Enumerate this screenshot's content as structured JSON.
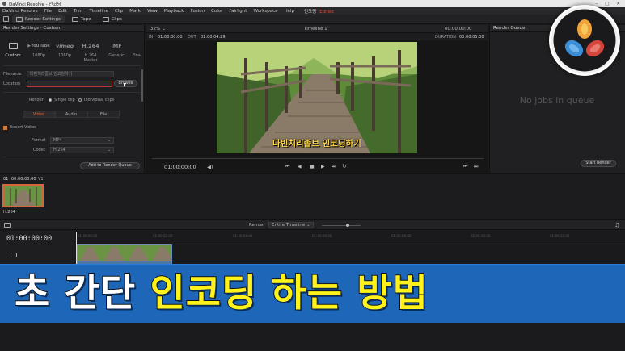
{
  "window": {
    "title": "DaVinci Resolve - 인코딩",
    "controls": [
      "–",
      "□",
      "✕"
    ]
  },
  "menu": {
    "items": [
      "DaVinci Resolve",
      "File",
      "Edit",
      "Trim",
      "Timeline",
      "Clip",
      "Mark",
      "View",
      "Playback",
      "Fusion",
      "Color",
      "Fairlight",
      "Workspace",
      "Help"
    ],
    "project_name": "인코딩",
    "edited_label": "Edited"
  },
  "page_tabs": {
    "render_settings": "Render Settings",
    "tape": "Tape",
    "clips": "Clips"
  },
  "render_settings": {
    "header": "Render Settings - Custom",
    "presets": [
      {
        "logo": "",
        "label": "Custom"
      },
      {
        "logo": "▶YouTube",
        "label": "1080p"
      },
      {
        "logo": "vimeo",
        "label": "1080p"
      },
      {
        "logo": "H.264",
        "label": "H.264 Master"
      },
      {
        "logo": "IMF",
        "label": "Generic"
      },
      {
        "logo": "",
        "label": "Final"
      }
    ],
    "filename_label": "Filename",
    "filename_value": "다빈치리졸브 인코딩하기",
    "location_label": "Location",
    "location_value": "",
    "browse_label": "Browse",
    "render_label": "Render",
    "single_clip_label": "Single clip",
    "individual_clips_label": "Individual clips",
    "tabs": [
      "Video",
      "Audio",
      "File"
    ],
    "export_video_label": "Export Video",
    "format_label": "Format",
    "format_value": "MP4",
    "codec_label": "Codec",
    "codec_value": "H.264",
    "add_to_queue_label": "Add to Render Queue"
  },
  "viewer": {
    "zoom": "32%",
    "timeline_name": "Timeline 1",
    "timecode_top": "00:00:00:00",
    "in_label": "IN",
    "in_value": "01:00:00:00",
    "out_label": "OUT",
    "out_value": "01:00:04:29",
    "duration_label": "DURATION",
    "duration_value": "00:00:05:00",
    "caption": "다빈치리졸브 인코딩하기",
    "current_timecode": "01:00:00:00"
  },
  "render_queue": {
    "header": "Render Queue",
    "empty_text": "No jobs in queue",
    "start_render_label": "Start Render"
  },
  "clips": {
    "index": "01",
    "timecode": "00:00:00:00",
    "track": "V1",
    "clip_label": "H.264"
  },
  "timeline": {
    "render_label": "Render",
    "render_option": "Entire Timeline",
    "timecode": "01:00:00:00",
    "ruler_ticks": [
      "01:00:00:00",
      "01:00:02:00",
      "01:00:04:00",
      "01:00:06:00",
      "01:00:08:00",
      "01:00:10:00",
      "01:00:12:00",
      "01:00:14:00",
      "01:00:16:00"
    ]
  },
  "banner": {
    "white_text": "초 간단",
    "yellow_text": "인코딩 하는 방법"
  },
  "colors": {
    "accent_orange": "#d4683d",
    "banner_blue": "#1e66b8",
    "banner_yellow": "#fff21a",
    "caption_yellow": "#ffd84a"
  },
  "icons": [
    "render-settings-icon",
    "tape-icon",
    "clips-icon",
    "davinci-logo-icon"
  ]
}
